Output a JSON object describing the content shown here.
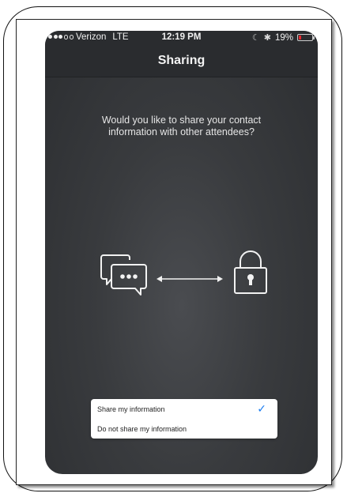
{
  "status_bar": {
    "carrier": "Verizon",
    "network": "LTE",
    "time": "12:19 PM",
    "battery": "19%",
    "battery_level": 0.19,
    "signal_bars_filled": 3,
    "signal_bars_total": 5,
    "battery_color": "#e8262d"
  },
  "nav": {
    "title": "Sharing"
  },
  "main": {
    "question": "Would you like to share your contact information with other attendees?",
    "icons": [
      "chat-bubbles-icon",
      "double-arrow-icon",
      "padlock-icon"
    ]
  },
  "sheet": {
    "options": [
      {
        "label": "Share my information",
        "selected": true
      },
      {
        "label": "Do not share my information",
        "selected": false
      }
    ],
    "check_glyph": "✓",
    "accent_color": "#1a7cf0"
  }
}
